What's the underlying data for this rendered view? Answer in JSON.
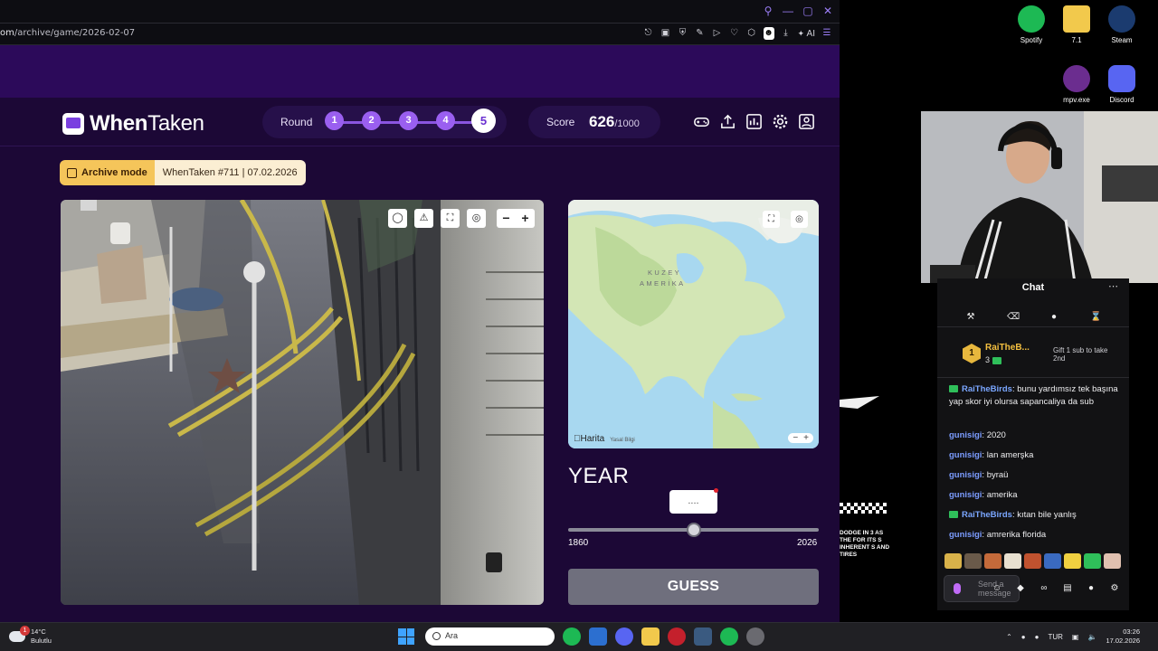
{
  "browser": {
    "url_prefix": "om",
    "url_path": "/archive/game/2026-02-07",
    "toolbar_ai": "AI"
  },
  "site": {
    "logo_bold": "When",
    "logo_rest": "Taken",
    "round_label": "Round",
    "rounds": [
      "1",
      "2",
      "3",
      "4",
      "5"
    ],
    "active_round": "5",
    "score_label": "Score",
    "score_value": "626",
    "score_max": "/1000",
    "archive_mode": "Archive mode",
    "archive_info": "WhenTaken #711 | 07.02.2026"
  },
  "map": {
    "continent_label_1": "KUZEY",
    "continent_label_2": "AMERİKA",
    "brand": "Harita",
    "legal": "Yasal Bilgi",
    "zoom_out": "−",
    "zoom_in": "+"
  },
  "year": {
    "title": "YEAR",
    "placeholder": "....",
    "slider_min": "1860",
    "slider_max": "2026",
    "slider_fraction": 0.5,
    "guess_label": "GUESS"
  },
  "desktop": {
    "icons": [
      {
        "label": "Spotify",
        "color": "#1db954"
      },
      {
        "label": "7.1",
        "color": "#f2c94c"
      },
      {
        "label": "Steam",
        "color": "#1b3b6f"
      },
      {
        "label": "mpv.exe",
        "color": "#6b2d8f"
      },
      {
        "label": "Discord",
        "color": "#5865f2"
      }
    ]
  },
  "chat": {
    "title": "Chat",
    "leader_rank": "1",
    "leader_name": "RaiTheB...",
    "leader_count": "3",
    "gift_text": "Gift 1 sub to take 2nd",
    "messages": [
      {
        "user": "RaiTheBirds",
        "text": ": bunu yardımsız tek başına yap skor iyi olursa sapancaliya da sub",
        "badge": true
      },
      {
        "user": "gunisigi",
        "text": ": 2020",
        "badge": false
      },
      {
        "user": "gunisigi",
        "text": ": lan amerşka",
        "badge": false
      },
      {
        "user": "gunisigi",
        "text": ": byraü",
        "badge": false
      },
      {
        "user": "gunisigi",
        "text": ": amerika",
        "badge": false
      },
      {
        "user": "RaiTheBirds",
        "text": ": kıtan bile yanlış",
        "badge": true
      },
      {
        "user": "gunisigi",
        "text": ": amrerika florida",
        "badge": false
      }
    ],
    "input_placeholder": "Send a message"
  },
  "overlay": {
    "text": "DODGE IN 3 AS THE FOR ITS S INHERENT S AND TIRES"
  },
  "taskbar": {
    "temp": "14°C",
    "condition": "Bulutlu",
    "weather_badge": "1",
    "search_placeholder": "Ara",
    "lang": "TUR",
    "time": "03:26",
    "date": "17.02.2026"
  }
}
